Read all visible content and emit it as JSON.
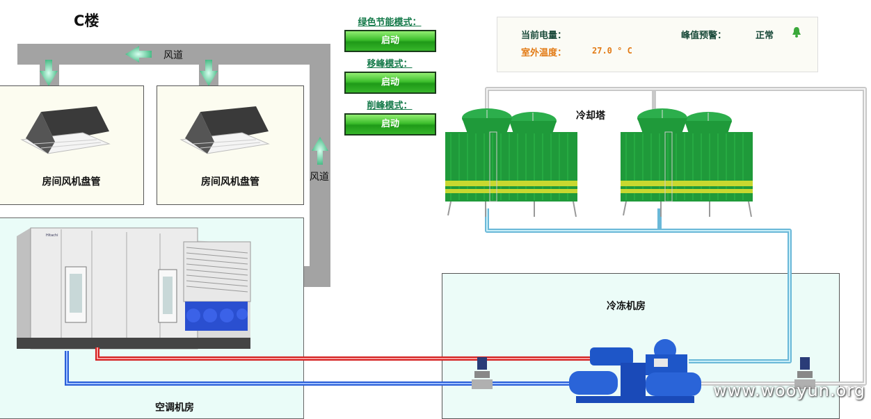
{
  "building": {
    "title": "C楼"
  },
  "ducts": {
    "top_label": "风道",
    "left_down_label": "风道",
    "mid_down_label": "风道",
    "right_up_label": "风道",
    "supply_label": "风道"
  },
  "rooms": {
    "left_fcu": {
      "label": "房间风机盘管"
    },
    "right_fcu": {
      "label": "房间风机盘管"
    },
    "ahu_room": {
      "label": "空调机房"
    },
    "chiller_room": {
      "label": "冷冻机房"
    }
  },
  "cooling_tower": {
    "label": "冷却塔"
  },
  "modes": [
    {
      "title": "绿色节能模式：",
      "button": "启动"
    },
    {
      "title": "移峰模式：",
      "button": "启动"
    },
    {
      "title": "削峰模式：",
      "button": "启动"
    }
  ],
  "status": {
    "power_label": "当前电量：",
    "power_value": "",
    "peak_label": "峰值预警：",
    "peak_value": "正常",
    "temp_label": "室外温度：",
    "temp_value": "27.0 ° C",
    "bell_icon": "bell-icon"
  },
  "colors": {
    "duct": "#a0a0a0",
    "cold_pipe": "#2a5ed8",
    "hot_pipe": "#d42020",
    "condenser_pipe": "#7cc8e0",
    "tower_green": "#1f9a3a",
    "button_green": "#2fb02a"
  },
  "watermark": "www.wooyun.org"
}
